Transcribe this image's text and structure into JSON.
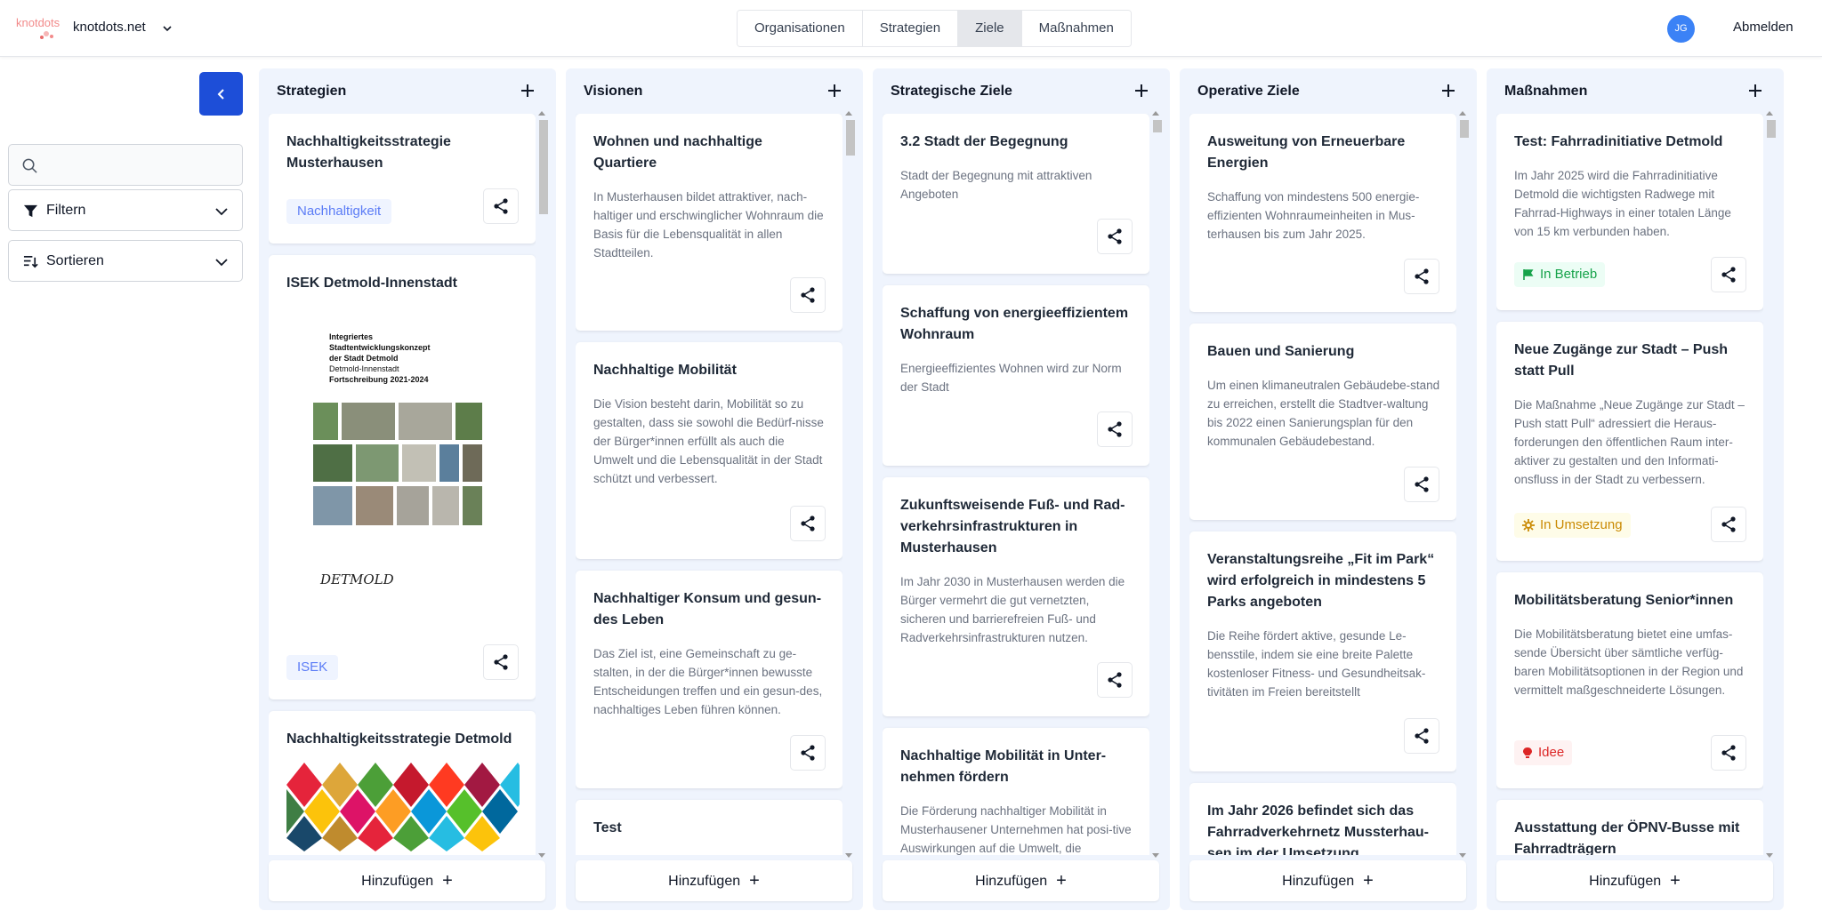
{
  "header": {
    "brand": "knotdots.net",
    "logo_text": "knotdots",
    "nav": [
      "Organisationen",
      "Strategien",
      "Ziele",
      "Maßnahmen"
    ],
    "nav_active": "Ziele",
    "avatar_initials": "JG",
    "logout_label": "Abmelden"
  },
  "sidebar": {
    "search_value": "",
    "filter_label": "Filtern",
    "sort_label": "Sortieren"
  },
  "columns": {
    "strategies": {
      "title": "Strategien",
      "add_label": "Hinzufügen",
      "cards": [
        {
          "title": "Nachhaltigkeitsstrategie Musterhausen",
          "tag": "Nachhaltigkeit"
        },
        {
          "title": "ISEK Detmold-Innenstadt",
          "tag": "ISEK",
          "cover_lines": [
            "Integriertes",
            "Stadtentwicklungskonzept",
            "der Stadt Detmold",
            "Detmold-Innenstadt",
            "Fortschreibung 2021-2024"
          ],
          "cover_logo": "DETMOLD"
        },
        {
          "title": "Nachhaltigkeitsstrategie Detmold"
        }
      ]
    },
    "visions": {
      "title": "Visionen",
      "add_label": "Hinzufügen",
      "cards": [
        {
          "title": "Wohnen und nachhaltige Quartiere",
          "desc": "In Musterhausen bildet attraktiver, nach-haltiger und erschwinglicher Wohnraum die Basis für die Lebensqualität in allen Stadtteilen."
        },
        {
          "title": "Nachhaltige Mobilität",
          "desc": "Die Vision besteht darin, Mobilität so zu gestalten, dass sie sowohl die Bedürf-nisse der Bürger*innen erfüllt als auch die Umwelt und die Lebensqualität in der Stadt schützt und verbessert."
        },
        {
          "title": "Nachhaltiger Konsum und gesun-des Leben",
          "desc": "Das Ziel ist, eine Gemeinschaft zu ge-stalten, in der die Bürger*innen bewusste Entscheidungen treffen und ein gesun-des, nachhaltiges Leben führen können."
        },
        {
          "title": "Test"
        }
      ]
    },
    "strategic_goals": {
      "title": "Strategische Ziele",
      "add_label": "Hinzufügen",
      "cards": [
        {
          "title": "3.2 Stadt der Begegnung",
          "desc": "Stadt der Begegnung mit attraktiven Angeboten"
        },
        {
          "title": "Schaffung von energieeffizientem Wohnraum",
          "desc": "Energieeffizientes Wohnen wird zur Norm der Stadt"
        },
        {
          "title": "Zukunftsweisende Fuß- und Rad-verkehrsinfrastrukturen in Musterhausen",
          "desc": "Im Jahr 2030 in Musterhausen werden die Bürger vermehrt die gut vernetzten, sicheren und barrierefreien Fuß- und Radverkehrsinfrastrukturen nutzen."
        },
        {
          "title": "Nachhaltige Mobilität in Unter-nehmen fördern",
          "desc": "Die Förderung nachhaltiger Mobilität in Musterhausener Unternehmen hat posi-tive Auswirkungen auf die Umwelt, die"
        }
      ]
    },
    "operative_goals": {
      "title": "Operative Ziele",
      "add_label": "Hinzufügen",
      "cards": [
        {
          "title": "Ausweitung von Erneuerbare Energien",
          "desc": "Schaffung von mindestens 500 energie-effizienten Wohnraumeinheiten in Mus-terhausen bis zum Jahr 2025."
        },
        {
          "title": "Bauen und Sanierung",
          "desc": "Um einen klimaneutralen Gebäudebe-stand zu erreichen, erstellt die Stadtver-waltung bis 2022 einen Sanierungsplan für den kommunalen Gebäudebestand."
        },
        {
          "title": "Veranstaltungsreihe „Fit im Park“ wird erfolgreich in mindestens 5 Parks angeboten",
          "desc": "Die Reihe fördert aktive, gesunde Le-bensstile, indem sie eine breite Palette kostenloser Fitness- und Gesundheitsak-tivitäten im Freien bereitstellt"
        },
        {
          "title": "Im Jahr 2026 befindet sich das Fahrradverkehrnetz Mussterhau-sen im der Umsetzung"
        }
      ]
    },
    "measures": {
      "title": "Maßnahmen",
      "add_label": "Hinzufügen",
      "cards": [
        {
          "title": "Test: Fahrradinitiative Detmold",
          "desc": "Im Jahr 2025 wird die Fahrradinitiative Detmold die wichtigsten Radwege mit Fahrrad-Highways in einer totalen Länge von 15 km verbunden haben.",
          "status": "In Betrieb",
          "status_color": "#16a34a"
        },
        {
          "title": "Neue Zugänge zur Stadt – Push statt Pull",
          "desc": "Die Maßnahme „Neue Zugänge zur Stadt – Push statt Pull“ adressiert die Heraus-forderungen den öffentlichen Raum inter-aktiver zu gestalten und den Informati-onsfluss in der Stadt zu verbessern.",
          "status": "In Umsetzung",
          "status_color": "#ca8a04"
        },
        {
          "title": "Mobilitätsberatung Senior*innen",
          "desc": "Die Mobilitätsberatung bietet eine umfas-sende Übersicht über sämtliche verfüg-baren Mobilitätsoptionen in der Region und vermittelt maßgeschneiderte Lösungen.",
          "status": "Idee",
          "status_color": "#dc2626"
        },
        {
          "title": "Ausstattung der ÖPNV-Busse mit Fahrradträgern"
        }
      ]
    }
  },
  "colors": {
    "accent": "#1d4ed8",
    "column_bg": "#eff4fd",
    "avatar": "#3b82f6"
  }
}
